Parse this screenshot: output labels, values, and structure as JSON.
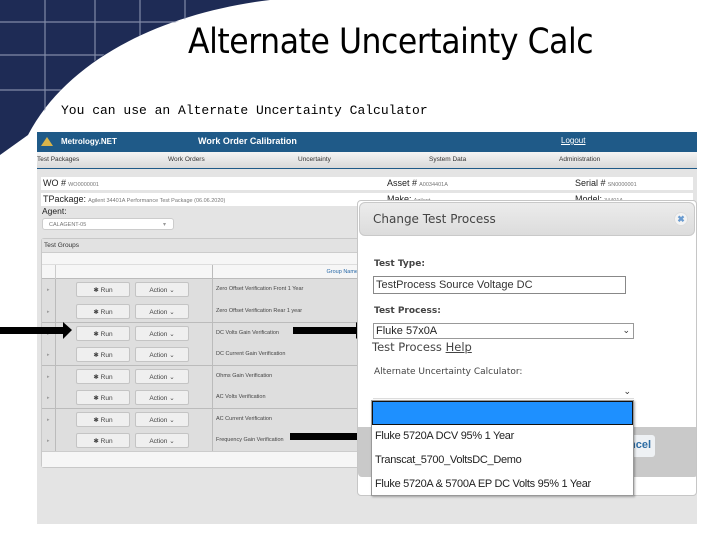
{
  "slide": {
    "title": "Alternate Uncertainty Calc",
    "subtitle": "You can use an Alternate Uncertainty Calculator"
  },
  "app": {
    "brand": "Metrology.NET",
    "title": "Work Order Calibration",
    "logout": "Logout",
    "nav": [
      "Test Packages",
      "Work Orders",
      "Uncertainty",
      "System Data",
      "Administration"
    ],
    "info": {
      "wo_label": "WO #",
      "wo_value": "WO0000001",
      "asset_label": "Asset #",
      "asset_value": "A0034401A",
      "serial_label": "Serial #",
      "serial_value": "SN0000001",
      "tpackage_label": "TPackage:",
      "tpackage_value": "Agilent 34401A Performance Test Package (06.06.2020)",
      "make_label": "Make:",
      "make_value": "Agilent",
      "model_label": "Model:",
      "model_value": "34401A"
    },
    "agent_label": "Agent:",
    "agent_value": "CALAGENT-05",
    "test_groups": {
      "title": "Test Groups",
      "column_header": "Group Name",
      "run_label": "Run",
      "action_label": "Action",
      "rows": [
        "Zero Offset Verification Front 1 Year",
        "Zero Offset Verification Rear 1 year",
        "DC Volts Gain Verification",
        "DC Current Gain Verification",
        "Ohms Gain Verification",
        "AC Volts Verification",
        "AC Current Verification",
        "Frequency Gain Verification"
      ]
    }
  },
  "modal": {
    "title": "Change Test Process",
    "close_icon": "close-icon",
    "test_type_label": "Test Type:",
    "test_type_value": "TestProcess Source Voltage DC",
    "test_process_label": "Test Process:",
    "test_process_value": "Fluke 57x0A",
    "help_prefix": "Test Process ",
    "help_link": "Help",
    "alt_calc_label": "Alternate Uncertainty Calculator:",
    "alt_calc_value": "",
    "cancel_label": "Cancel"
  },
  "dropdown": {
    "options": [
      "",
      "Fluke 5720A DCV 95% 1 Year",
      "Transcat_5700_VoltsDC_Demo",
      "Fluke 5720A & 5700A EP DC Volts 95% 1 Year"
    ],
    "selected_index": 0
  }
}
